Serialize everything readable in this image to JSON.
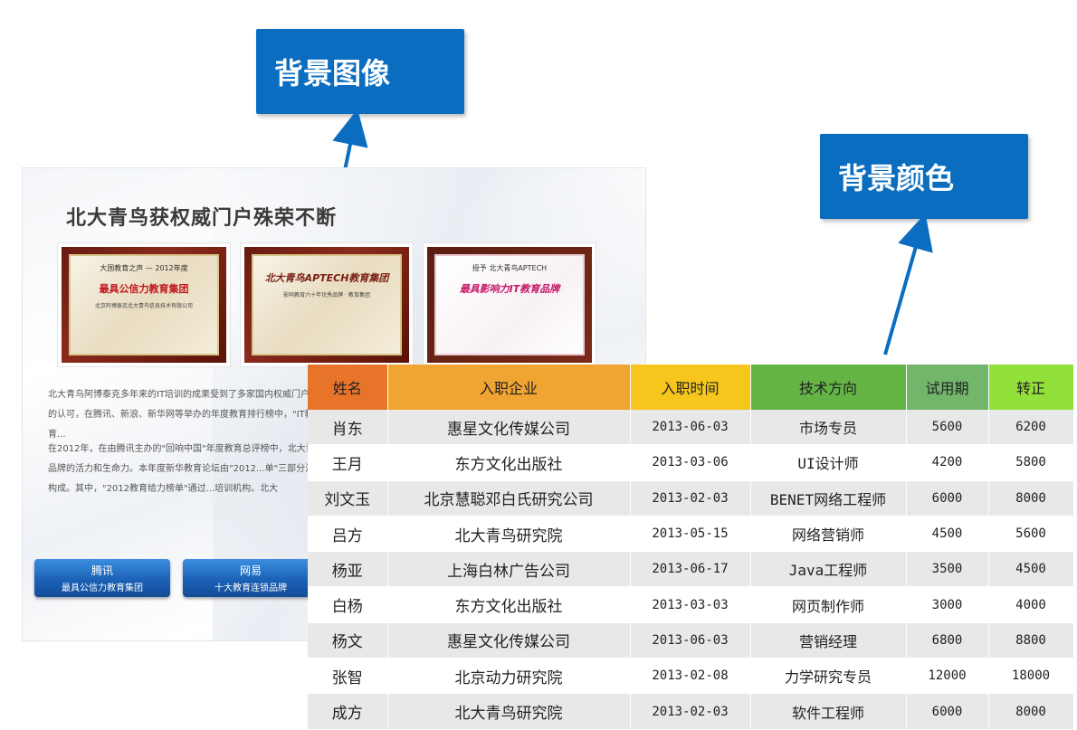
{
  "callouts": {
    "background_image": "背景图像",
    "background_color": "背景颜色"
  },
  "panel": {
    "title": "北大青鸟获权威门户殊荣不断",
    "plaques": [
      {
        "top": "大国教育之声 — 2012年度",
        "main": "最具公信力教育集团",
        "sub": "北京阿博泰克北大青鸟信息技术有限公司"
      },
      {
        "top": "",
        "main": "北大青鸟APTECH教育集团",
        "sub": "影响教育六十年优秀品牌 · 教育集团"
      },
      {
        "top": "授予 北大青鸟APTECH",
        "main": "最具影响力IT教育品牌",
        "sub": ""
      }
    ],
    "paragraph1": "北大青鸟阿博泰克多年来的IT培训的成果受到了多家国内权威门户网站的认可，在腾讯、新浪、新华网等举办的年度教育排行榜中，\"IT教育...",
    "paragraph2": "在2012年，在由腾讯主办的\"回响中国\"年度教育总评榜中，北大青鸟品牌的活力和生命力。本年度新华教育论坛由\"2012...单\"三部分活动构成。其中，\"2012教育给力榜单\"通过...培训机构。北大",
    "tabs": [
      {
        "line1": "腾讯",
        "line2": "最具公信力教育集团"
      },
      {
        "line1": "网易",
        "line2": "十大教育连锁品牌"
      }
    ]
  },
  "table": {
    "headers": [
      {
        "label": "姓名",
        "color": "#e8742a"
      },
      {
        "label": "入职企业",
        "color": "#f0a431"
      },
      {
        "label": "入职时间",
        "color": "#f6c61d"
      },
      {
        "label": "技术方向",
        "color": "#63b345"
      },
      {
        "label": "试用期",
        "color": "#71b66b"
      },
      {
        "label": "转正",
        "color": "#93e03a"
      }
    ],
    "rows": [
      [
        "肖东",
        "惠星文化传媒公司",
        "2013-06-03",
        "市场专员",
        "5600",
        "6200"
      ],
      [
        "王月",
        "东方文化出版社",
        "2013-03-06",
        "UI设计师",
        "4200",
        "5800"
      ],
      [
        "刘文玉",
        "北京慧聪邓白氏研究公司",
        "2013-02-03",
        "BENET网络工程师",
        "6000",
        "8000"
      ],
      [
        "吕方",
        "北大青鸟研究院",
        "2013-05-15",
        "网络营销师",
        "4500",
        "5600"
      ],
      [
        "杨亚",
        "上海白林广告公司",
        "2013-06-17",
        "Java工程师",
        "3500",
        "4500"
      ],
      [
        "白杨",
        "东方文化出版社",
        "2013-03-03",
        "网页制作师",
        "3000",
        "4000"
      ],
      [
        "杨文",
        "惠星文化传媒公司",
        "2013-06-03",
        "营销经理",
        "6800",
        "8800"
      ],
      [
        "张智",
        "北京动力研究院",
        "2013-02-08",
        "力学研究专员",
        "12000",
        "18000"
      ],
      [
        "成方",
        "北大青鸟研究院",
        "2013-02-03",
        "软件工程师",
        "6000",
        "8000"
      ]
    ]
  }
}
